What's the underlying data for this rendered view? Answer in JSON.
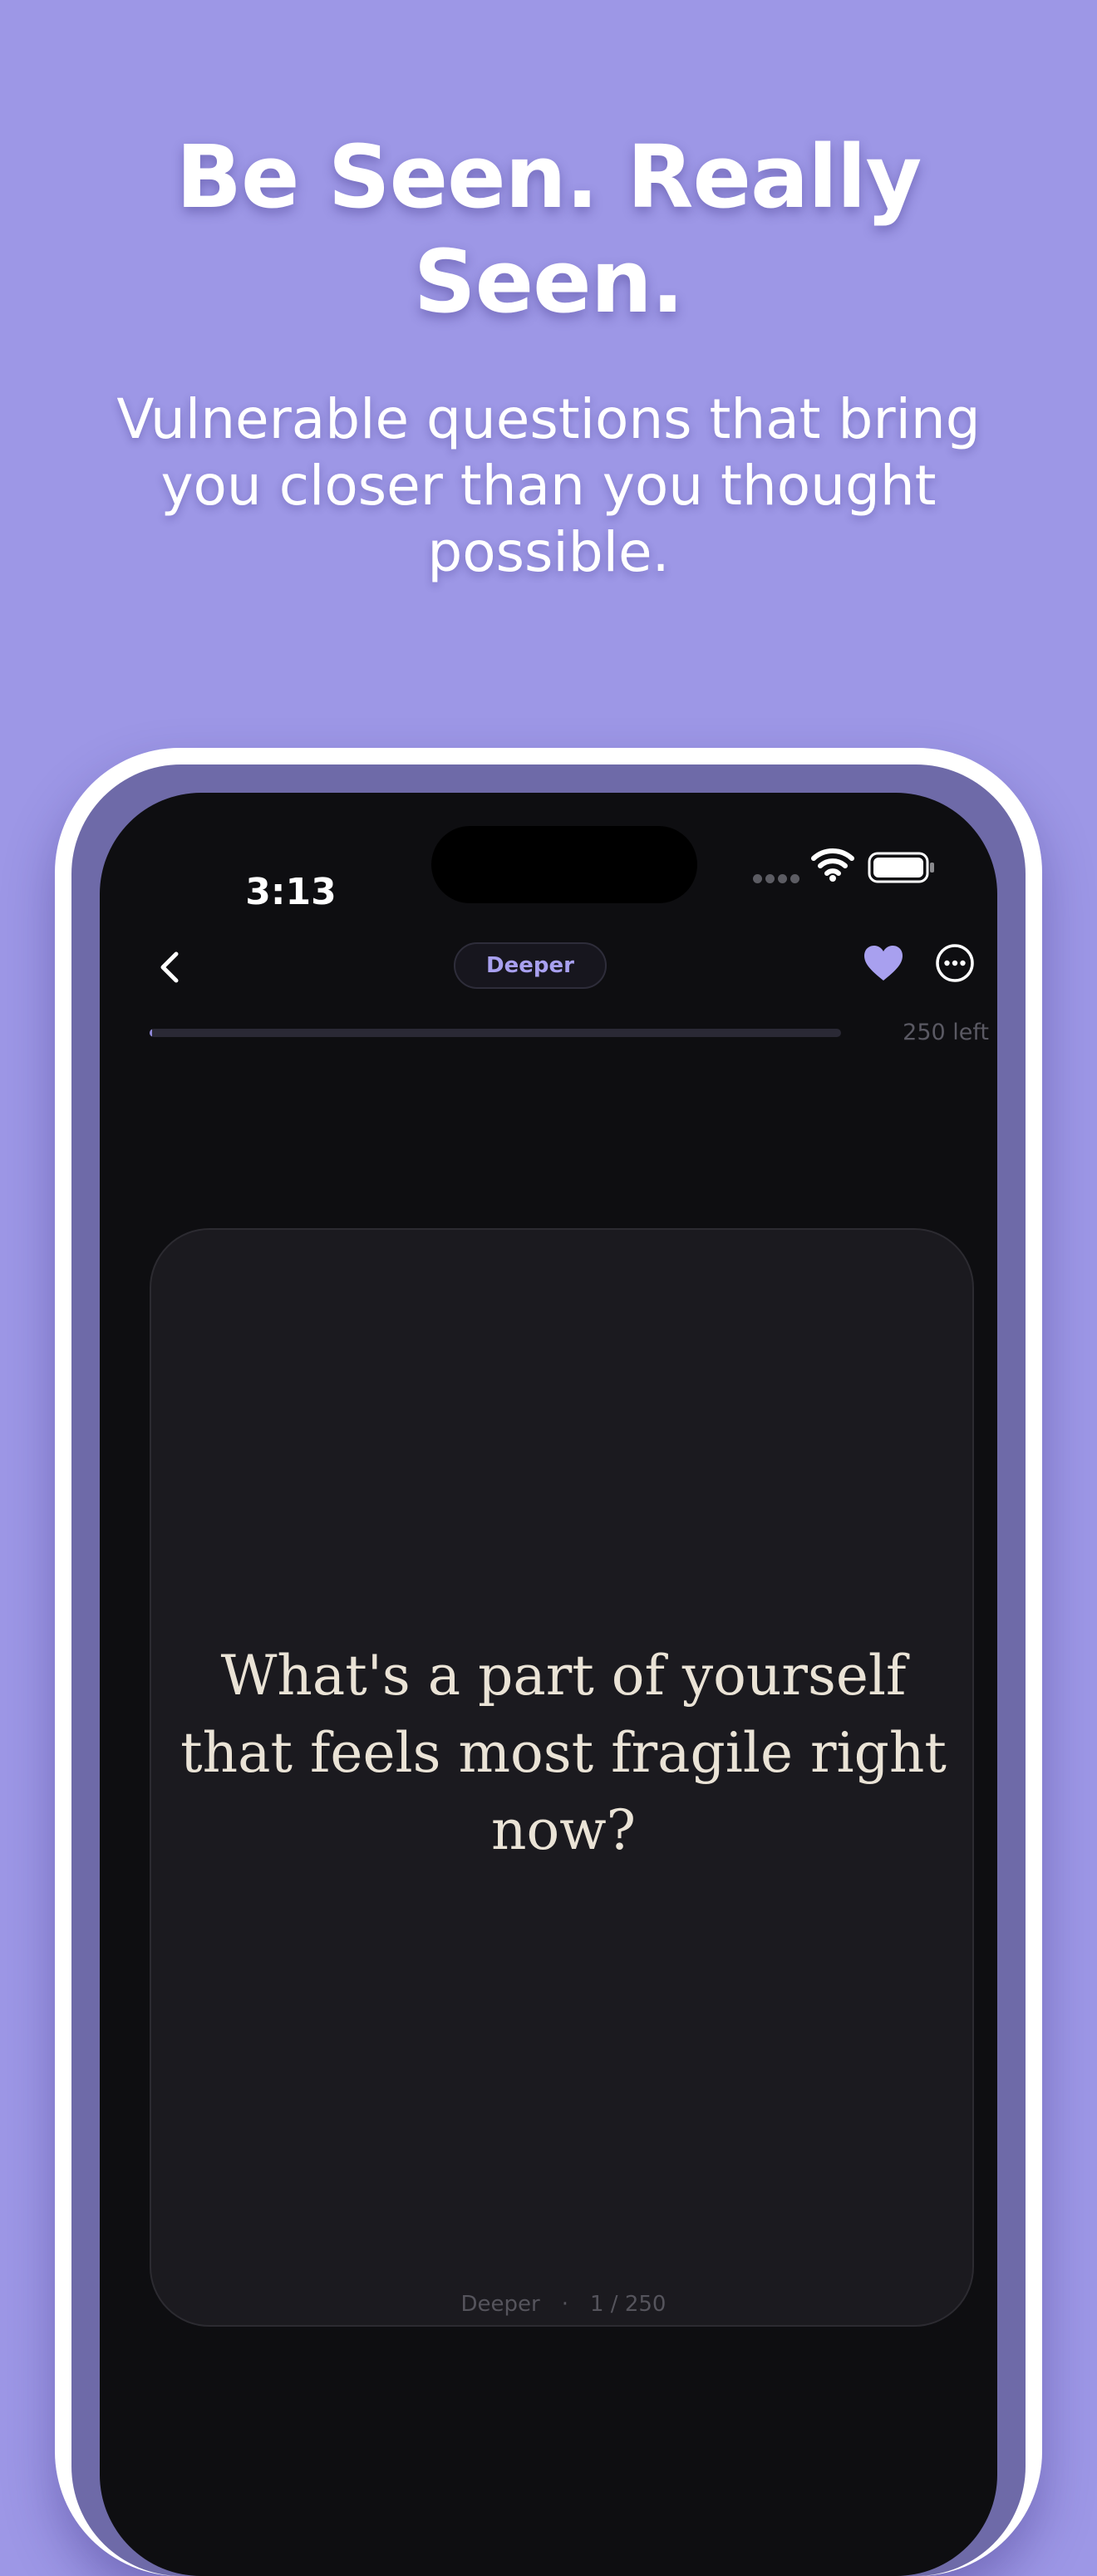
{
  "headline": {
    "line1": "Be Seen. Really",
    "line2": "Seen."
  },
  "subheadline": {
    "line1": "Vulnerable questions that bring",
    "line2": "you closer than you thought",
    "line3": "possible."
  },
  "status_bar": {
    "time": "3:13"
  },
  "toolbar": {
    "back_icon": "chevron-left-icon",
    "category": "Deeper",
    "favorite_icon": "heart-icon",
    "more_icon": "ellipsis-circle-icon"
  },
  "progress": {
    "remaining": "250 left",
    "fraction": 0.004
  },
  "card": {
    "question_line1": "What's a part of yourself",
    "question_line2": "that feels most fragile right",
    "question_line3": "now?",
    "footer_category": "Deeper",
    "footer_separator": "·",
    "footer_count": "1 / 250"
  },
  "colors": {
    "background": "#9d97e6",
    "screen": "#0e0e11",
    "card": "#1b1a1f",
    "accent": "#a8a0ef",
    "question_text": "#eae3d6"
  }
}
